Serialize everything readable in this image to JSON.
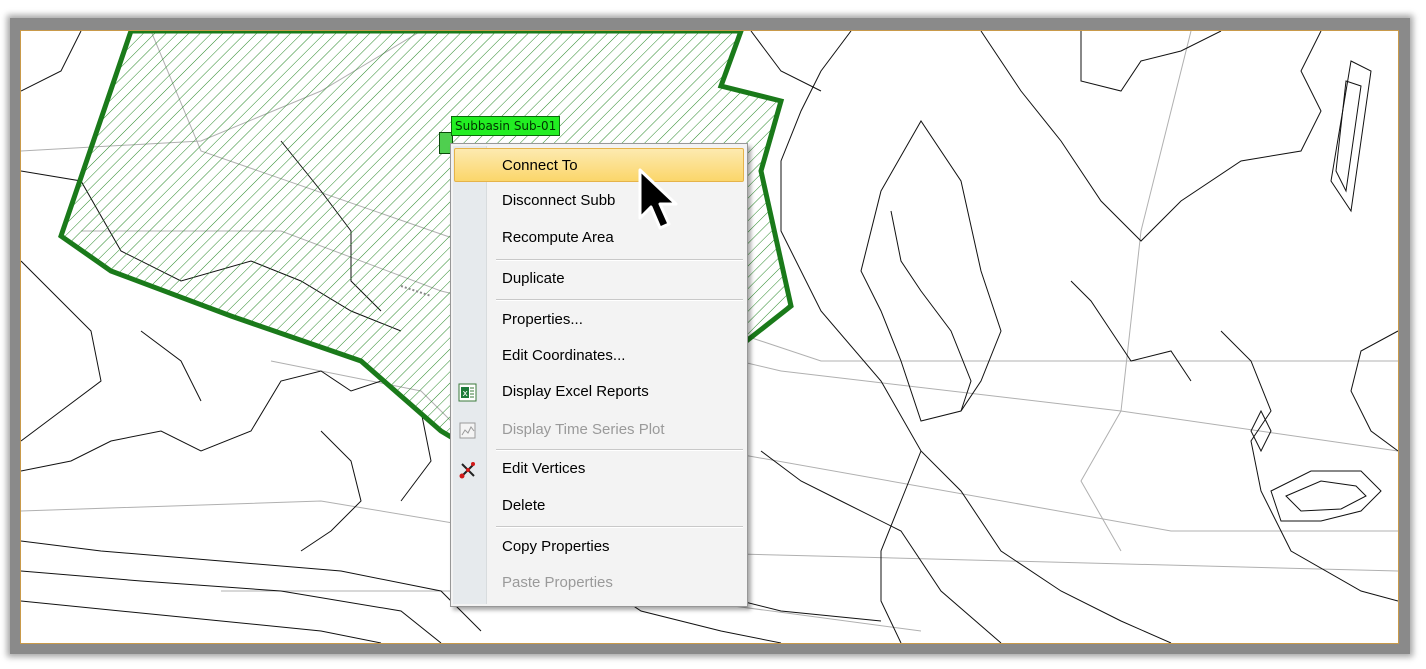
{
  "subbasin": {
    "label": "Subbasin Sub-01"
  },
  "menu": {
    "items": [
      {
        "label": "Connect To",
        "state": "highlighted"
      },
      {
        "label": "Disconnect Subb",
        "state": "normal"
      },
      {
        "label": "Recompute Area",
        "state": "normal"
      },
      {
        "label": "Duplicate",
        "state": "normal"
      },
      {
        "label": "Properties...",
        "state": "normal"
      },
      {
        "label": "Edit Coordinates...",
        "state": "normal"
      },
      {
        "label": "Display Excel Reports",
        "state": "normal",
        "icon": "excel-icon"
      },
      {
        "label": "Display Time Series Plot",
        "state": "disabled",
        "icon": "time-series-plot-icon"
      },
      {
        "label": "Edit Vertices",
        "state": "normal",
        "icon": "edit-vertices-icon"
      },
      {
        "label": "Delete",
        "state": "normal"
      },
      {
        "label": "Copy Properties",
        "state": "normal"
      },
      {
        "label": "Paste Properties",
        "state": "disabled"
      }
    ]
  },
  "colors": {
    "subbasin_outline": "#1a7a1a",
    "subbasin_label_bg": "#22ee22",
    "menu_highlight": "#fbd66a",
    "frame_border": "#c99a4a"
  }
}
